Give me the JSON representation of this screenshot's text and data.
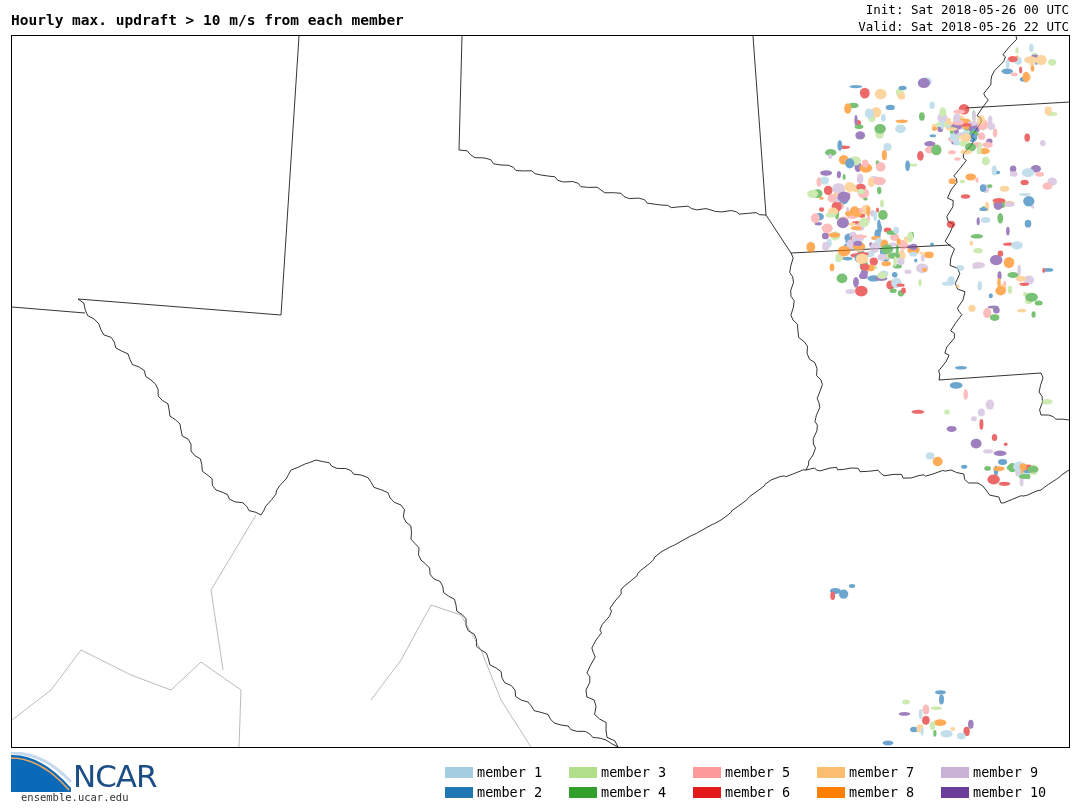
{
  "title": "Hourly max. updraft > 10 m/s from each member",
  "init": "Init: Sat 2018-05-26 00 UTC",
  "valid": "Valid: Sat 2018-05-26 22 UTC",
  "logo": {
    "wordmark": "NCAR",
    "url": "ensemble.ucar.edu"
  },
  "legend": [
    {
      "label": "member 1",
      "color": "#a6cee3"
    },
    {
      "label": "member 2",
      "color": "#1f78b4"
    },
    {
      "label": "member 3",
      "color": "#b2df8a"
    },
    {
      "label": "member 4",
      "color": "#33a02c"
    },
    {
      "label": "member 5",
      "color": "#fb9a99"
    },
    {
      "label": "member 6",
      "color": "#e31a1c"
    },
    {
      "label": "member 7",
      "color": "#fdbf6f"
    },
    {
      "label": "member 8",
      "color": "#ff7f00"
    },
    {
      "label": "member 9",
      "color": "#cab2d6"
    },
    {
      "label": "member 10",
      "color": "#6a3d9a"
    }
  ]
}
